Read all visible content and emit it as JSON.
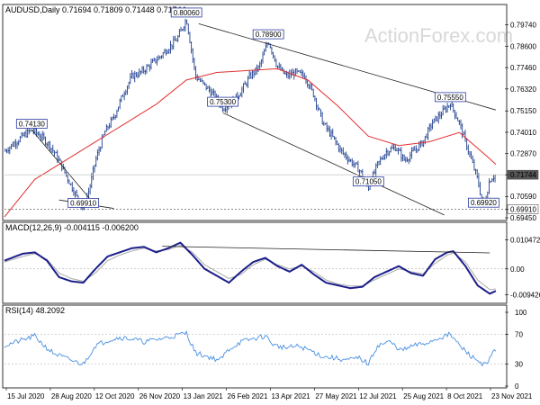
{
  "header": {
    "title": "AUDUSD,Daily  0.71694 0.71809 0.71448 0.71744",
    "watermark": "ActionForex.com"
  },
  "colors": {
    "candle": "#1f3f8f",
    "ma": "#e03030",
    "macd": "#1b1f8a",
    "macd_signal": "#aaaaaa",
    "rsi": "#4a90e2",
    "trend": "#222222",
    "label_border": "#2a3aa0"
  },
  "chart_data": [
    {
      "type": "line",
      "panel": "price",
      "title": "AUDUSD,Daily  0.71694 0.71809 0.71448 0.71744",
      "series": [
        {
          "name": "",
          "note": "price path waypoints",
          "points": [
            [
              0,
              0.73
            ],
            [
              3,
              0.734
            ],
            [
              6,
              0.738
            ],
            [
              9,
              0.7413
            ],
            [
              12,
              0.738
            ],
            [
              15,
              0.733
            ],
            [
              18,
              0.725
            ],
            [
              21,
              0.715
            ],
            [
              24,
              0.705
            ],
            [
              26,
              0.6991
            ],
            [
              28,
              0.71
            ],
            [
              30,
              0.725
            ],
            [
              33,
              0.74
            ],
            [
              36,
              0.748
            ],
            [
              39,
              0.76
            ],
            [
              42,
              0.77
            ],
            [
              45,
              0.772
            ],
            [
              48,
              0.776
            ],
            [
              51,
              0.78
            ],
            [
              54,
              0.785
            ],
            [
              57,
              0.79
            ],
            [
              60,
              0.8006
            ],
            [
              63,
              0.77
            ],
            [
              66,
              0.765
            ],
            [
              69,
              0.76
            ],
            [
              72,
              0.753
            ],
            [
              75,
              0.756
            ],
            [
              78,
              0.762
            ],
            [
              81,
              0.77
            ],
            [
              84,
              0.775
            ],
            [
              87,
              0.789
            ],
            [
              90,
              0.775
            ],
            [
              93,
              0.77
            ],
            [
              96,
              0.772
            ],
            [
              99,
              0.77
            ],
            [
              102,
              0.76
            ],
            [
              105,
              0.745
            ],
            [
              108,
              0.738
            ],
            [
              111,
              0.73
            ],
            [
              114,
              0.725
            ],
            [
              117,
              0.72
            ],
            [
              120,
              0.7105
            ],
            [
              123,
              0.723
            ],
            [
              126,
              0.73
            ],
            [
              129,
              0.732
            ],
            [
              132,
              0.725
            ],
            [
              135,
              0.73
            ],
            [
              138,
              0.735
            ],
            [
              141,
              0.745
            ],
            [
              144,
              0.75
            ],
            [
              147,
              0.7555
            ],
            [
              150,
              0.745
            ],
            [
              153,
              0.73
            ],
            [
              156,
              0.715
            ],
            [
              158,
              0.6992
            ],
            [
              160,
              0.715
            ],
            [
              162,
              0.7174
            ]
          ]
        },
        {
          "name": "",
          "note": "moving average",
          "points": [
            [
              0,
              0.695
            ],
            [
              10,
              0.715
            ],
            [
              20,
              0.725
            ],
            [
              30,
              0.735
            ],
            [
              40,
              0.745
            ],
            [
              50,
              0.755
            ],
            [
              60,
              0.768
            ],
            [
              70,
              0.772
            ],
            [
              80,
              0.773
            ],
            [
              90,
              0.774
            ],
            [
              100,
              0.768
            ],
            [
              110,
              0.754
            ],
            [
              120,
              0.738
            ],
            [
              130,
              0.733
            ],
            [
              140,
              0.735
            ],
            [
              150,
              0.74
            ],
            [
              160,
              0.726
            ],
            [
              162,
              0.723
            ]
          ]
        }
      ],
      "annotations": [
        {
          "text": "0.80060",
          "x": 60,
          "y": 0.8006
        },
        {
          "text": "0.78900",
          "x": 87,
          "y": 0.789
        },
        {
          "text": "0.75300",
          "x": 72,
          "y": 0.753
        },
        {
          "text": "0.74130",
          "x": 9,
          "y": 0.7413
        },
        {
          "text": "0.75550",
          "x": 147,
          "y": 0.7555
        },
        {
          "text": "0.71050",
          "x": 120,
          "y": 0.7105
        },
        {
          "text": "0.69910",
          "x": 26,
          "y": 0.6991
        },
        {
          "text": "0.69920",
          "x": 158,
          "y": 0.6992
        }
      ],
      "y_ticks": [
        "0.79740",
        "0.78600",
        "0.77460",
        "0.76320",
        "0.75150",
        "0.74010",
        "0.72870",
        "0.71744",
        "0.70590",
        "0.69910",
        "0.69450"
      ],
      "ylim": [
        0.6945,
        0.802
      ],
      "last_price": "0.71744",
      "support": "0.69910",
      "x_ticks": [
        "15 Jul 2020",
        "28 Aug 2020",
        "12 Oct 2020",
        "26 Nov 2020",
        "13 Jan 2021",
        "26 Feb 2021",
        "13 Apr 2021",
        "27 May 2021",
        "12 Jul 2021",
        "25 Aug 2021",
        "8 Oct 2021",
        "23 Nov 2021"
      ],
      "xlim": [
        0,
        165
      ]
    },
    {
      "type": "line",
      "panel": "macd",
      "title": "MACD(12,26,9) -0.004115 -0.006200",
      "y_ticks": [
        "0.010472",
        "0.00",
        "-0.009426"
      ],
      "ylim": [
        -0.0115,
        0.012
      ],
      "series": [
        {
          "name": "",
          "points": [
            [
              0,
              0.003
            ],
            [
              6,
              0.0055
            ],
            [
              10,
              0.006
            ],
            [
              14,
              0.003
            ],
            [
              18,
              -0.003
            ],
            [
              22,
              -0.0045
            ],
            [
              26,
              -0.005
            ],
            [
              30,
              0.0
            ],
            [
              34,
              0.0045
            ],
            [
              38,
              0.006
            ],
            [
              42,
              0.0075
            ],
            [
              46,
              0.008
            ],
            [
              50,
              0.006
            ],
            [
              54,
              0.0075
            ],
            [
              58,
              0.0095
            ],
            [
              62,
              0.005
            ],
            [
              66,
              0.0
            ],
            [
              70,
              -0.0025
            ],
            [
              74,
              -0.005
            ],
            [
              78,
              -0.001
            ],
            [
              82,
              0.0025
            ],
            [
              86,
              0.004
            ],
            [
              90,
              0.001
            ],
            [
              94,
              -0.001
            ],
            [
              98,
              0.0015
            ],
            [
              102,
              -0.002
            ],
            [
              106,
              -0.005
            ],
            [
              110,
              -0.006
            ],
            [
              114,
              -0.007
            ],
            [
              118,
              -0.0065
            ],
            [
              122,
              -0.003
            ],
            [
              126,
              -0.001
            ],
            [
              130,
              0.001
            ],
            [
              134,
              -0.0015
            ],
            [
              138,
              -0.0025
            ],
            [
              142,
              0.0035
            ],
            [
              146,
              0.006
            ],
            [
              148,
              0.0064
            ],
            [
              152,
              0.001
            ],
            [
              156,
              -0.006
            ],
            [
              160,
              -0.009
            ],
            [
              162,
              -0.008
            ]
          ]
        },
        {
          "name": "",
          "points": [
            [
              0,
              0.0025
            ],
            [
              6,
              0.0045
            ],
            [
              10,
              0.0055
            ],
            [
              14,
              0.0035
            ],
            [
              18,
              -0.0015
            ],
            [
              22,
              -0.0035
            ],
            [
              26,
              -0.0045
            ],
            [
              30,
              -0.0015
            ],
            [
              34,
              0.003
            ],
            [
              38,
              0.005
            ],
            [
              42,
              0.0065
            ],
            [
              46,
              0.0075
            ],
            [
              50,
              0.0065
            ],
            [
              54,
              0.007
            ],
            [
              58,
              0.0085
            ],
            [
              62,
              0.006
            ],
            [
              66,
              0.0015
            ],
            [
              70,
              -0.001
            ],
            [
              74,
              -0.0035
            ],
            [
              78,
              -0.002
            ],
            [
              82,
              0.0015
            ],
            [
              86,
              0.0035
            ],
            [
              90,
              0.0015
            ],
            [
              94,
              0.0
            ],
            [
              98,
              0.001
            ],
            [
              102,
              -0.001
            ],
            [
              106,
              -0.004
            ],
            [
              110,
              -0.0055
            ],
            [
              114,
              -0.0062
            ],
            [
              118,
              -0.0062
            ],
            [
              122,
              -0.004
            ],
            [
              126,
              -0.002
            ],
            [
              130,
              0.0
            ],
            [
              134,
              -0.001
            ],
            [
              138,
              -0.0018
            ],
            [
              142,
              0.002
            ],
            [
              146,
              0.005
            ],
            [
              148,
              0.0058
            ],
            [
              152,
              0.0025
            ],
            [
              156,
              -0.004
            ],
            [
              160,
              -0.0075
            ],
            [
              162,
              -0.0073
            ]
          ]
        }
      ]
    },
    {
      "type": "line",
      "panel": "rsi",
      "title": "RSI(14) 48.2092",
      "y_ticks": [
        "100",
        "70",
        "30",
        "0"
      ],
      "ylim": [
        0,
        100
      ],
      "series": [
        {
          "name": "",
          "points": [
            [
              0,
              55
            ],
            [
              4,
              60
            ],
            [
              8,
              65
            ],
            [
              10,
              68
            ],
            [
              13,
              55
            ],
            [
              16,
              45
            ],
            [
              20,
              38
            ],
            [
              24,
              32
            ],
            [
              26,
              30
            ],
            [
              30,
              55
            ],
            [
              34,
              62
            ],
            [
              38,
              66
            ],
            [
              42,
              64
            ],
            [
              46,
              60
            ],
            [
              50,
              63
            ],
            [
              54,
              66
            ],
            [
              58,
              70
            ],
            [
              60,
              72
            ],
            [
              63,
              45
            ],
            [
              67,
              40
            ],
            [
              71,
              35
            ],
            [
              74,
              50
            ],
            [
              78,
              60
            ],
            [
              82,
              64
            ],
            [
              86,
              68
            ],
            [
              89,
              55
            ],
            [
              93,
              52
            ],
            [
              97,
              54
            ],
            [
              101,
              48
            ],
            [
              105,
              40
            ],
            [
              109,
              38
            ],
            [
              113,
              35
            ],
            [
              117,
              38
            ],
            [
              120,
              30
            ],
            [
              123,
              55
            ],
            [
              127,
              60
            ],
            [
              131,
              48
            ],
            [
              135,
              55
            ],
            [
              139,
              58
            ],
            [
              143,
              65
            ],
            [
              147,
              70
            ],
            [
              150,
              55
            ],
            [
              154,
              40
            ],
            [
              157,
              32
            ],
            [
              159,
              28
            ],
            [
              161,
              45
            ],
            [
              162,
              48
            ]
          ]
        }
      ]
    }
  ]
}
